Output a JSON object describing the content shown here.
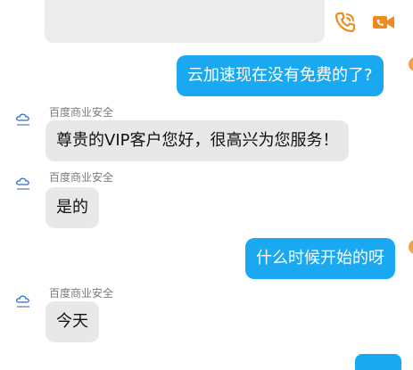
{
  "header": {
    "phone_icon": "phone-call-icon",
    "video_icon": "video-call-icon",
    "accent_color": "#f08a1c"
  },
  "colors": {
    "outgoing_bubble": "#1aa9f0",
    "incoming_bubble": "#e8e8e8"
  },
  "messages": [
    {
      "direction": "out",
      "text": "云加速现在没有免费的了?"
    },
    {
      "direction": "in",
      "sender": "百度商业安全",
      "text": "尊贵的VIP客户您好，很高兴为您服务！"
    },
    {
      "direction": "in",
      "sender": "百度商业安全",
      "text": "是的"
    },
    {
      "direction": "out",
      "text": "什么时候开始的呀"
    },
    {
      "direction": "in",
      "sender": "百度商业安全",
      "text": "今天"
    }
  ]
}
